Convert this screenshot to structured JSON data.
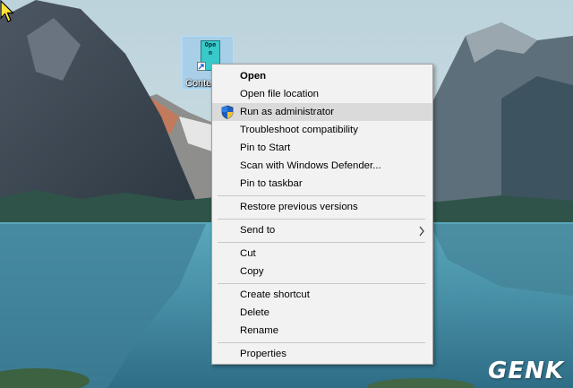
{
  "desktop": {
    "shortcut": {
      "label": "Conte",
      "icon_text": [
        "Ope",
        "n"
      ]
    },
    "watermark": "GENK"
  },
  "context_menu": {
    "groups": [
      [
        {
          "label": "Open",
          "bold": true
        },
        {
          "label": "Open file location"
        },
        {
          "label": "Run as administrator",
          "icon": "shield-icon",
          "highlighted": true
        },
        {
          "label": "Troubleshoot compatibility"
        },
        {
          "label": "Pin to Start"
        },
        {
          "label": "Scan with Windows Defender..."
        },
        {
          "label": "Pin to taskbar"
        }
      ],
      [
        {
          "label": "Restore previous versions"
        }
      ],
      [
        {
          "label": "Send to",
          "submenu": true
        }
      ],
      [
        {
          "label": "Cut"
        },
        {
          "label": "Copy"
        }
      ],
      [
        {
          "label": "Create shortcut"
        },
        {
          "label": "Delete"
        },
        {
          "label": "Rename"
        }
      ],
      [
        {
          "label": "Properties"
        }
      ]
    ]
  },
  "colors": {
    "menu_bg": "#f2f2f2",
    "highlight": "#dadada",
    "icon_bg": "#38c9c9"
  }
}
